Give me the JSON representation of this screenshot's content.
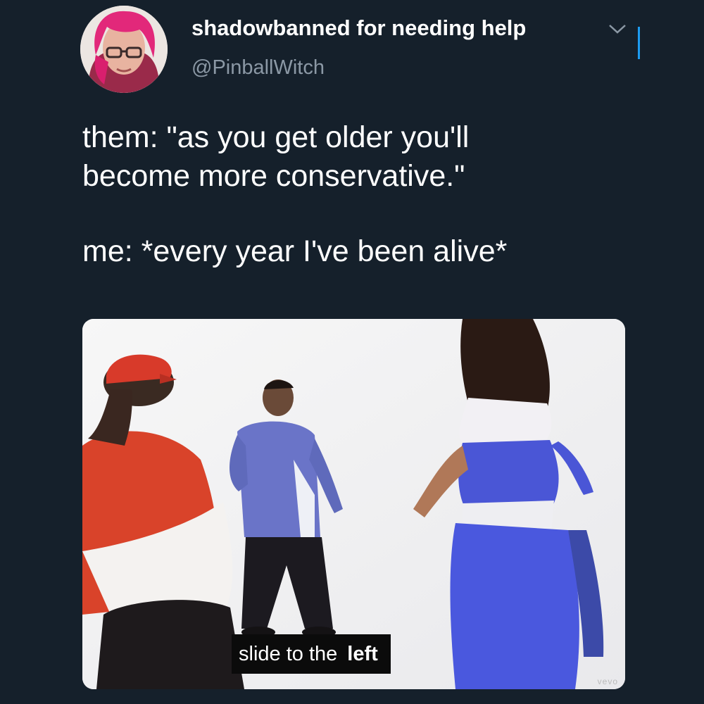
{
  "tweet": {
    "author": {
      "display_name": "shadowbanned for needing help",
      "handle": "@PinballWitch",
      "avatar_icon": "profile-photo"
    },
    "menu_icon": "chevron-down-icon",
    "text_lines": [
      "them: \"as you get older you'll",
      "become more conservative.\"",
      "me: *every year I've been alive*"
    ],
    "media": {
      "caption_part1": "slide to the",
      "caption_part2": "left",
      "watermark": "vevo"
    }
  },
  "colors": {
    "background": "#15202b",
    "handle": "#8b98a5",
    "accent": "#1d9bf0"
  }
}
